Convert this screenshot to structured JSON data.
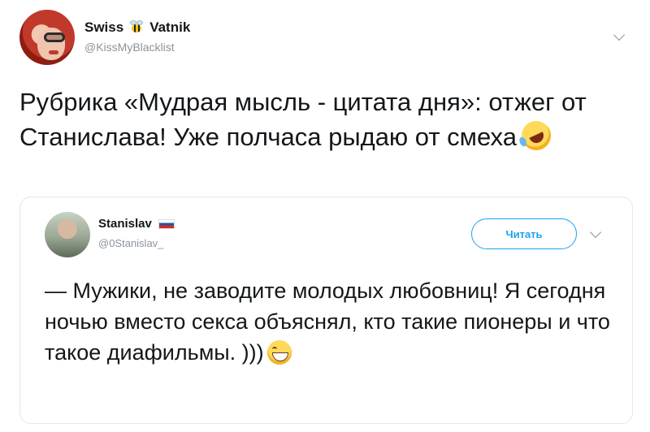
{
  "tweet": {
    "author_name_part1": "Swiss",
    "author_name_part2": "Vatnik",
    "author_icon": "bee-icon",
    "handle": "@KissMyBlacklist",
    "text": "Рубрика «Мудрая мысль - цитата дня»: отжег от Станислава! Уже полчаса рыдаю от смеха",
    "emoji": "rolling-on-floor-laughing-icon"
  },
  "quoted": {
    "author_name": "Stanislav",
    "author_flag": "russian-flag-icon",
    "handle": "@0Stanislav_",
    "follow_label": "Читать",
    "text": "— Мужики, не заводите молодых любовниц! Я сегодня ночью вместо секса объяснял, кто такие пионеры и что такое диафильмы. )))",
    "emoji": "grinning-face-icon"
  },
  "colors": {
    "accent": "#1da1f2",
    "text": "#14171a",
    "muted": "#8a939b",
    "border": "#e1e8ed"
  }
}
